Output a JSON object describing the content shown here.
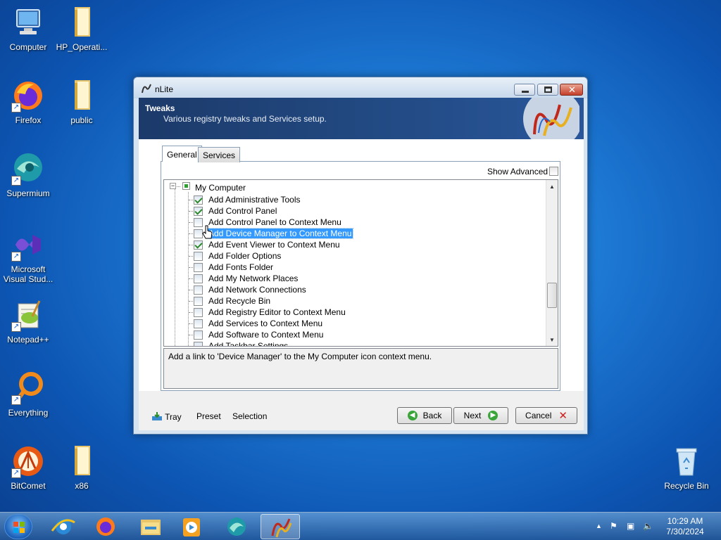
{
  "desktop": {
    "icons": [
      {
        "label": "Computer"
      },
      {
        "label": "HP_Operati..."
      },
      {
        "label": "Firefox"
      },
      {
        "label": "public"
      },
      {
        "label": "Supermium"
      },
      {
        "label": "Microsoft Visual Stud..."
      },
      {
        "label": "Notepad++"
      },
      {
        "label": "Everything"
      },
      {
        "label": "BitComet"
      },
      {
        "label": "x86"
      },
      {
        "label": "Recycle Bin"
      }
    ]
  },
  "window": {
    "title": "nLite",
    "header_title": "Tweaks",
    "header_subtitle": "Various registry tweaks and Services setup.",
    "tabs": [
      {
        "label": "General",
        "active": true
      },
      {
        "label": "Services",
        "active": false
      }
    ],
    "show_advanced_label": "Show Advanced",
    "show_advanced_checked": false,
    "tree_root": "My Computer",
    "tree_items": [
      {
        "label": "Add Administrative Tools",
        "checked": true
      },
      {
        "label": "Add Control Panel",
        "checked": true
      },
      {
        "label": "Add Control Panel to Context Menu",
        "checked": false
      },
      {
        "label": "Add Device Manager to Context Menu",
        "checked": false,
        "selected": true
      },
      {
        "label": "Add Event Viewer to Context Menu",
        "checked": true
      },
      {
        "label": "Add Folder Options",
        "checked": false
      },
      {
        "label": "Add Fonts Folder",
        "checked": false
      },
      {
        "label": "Add My Network Places",
        "checked": false
      },
      {
        "label": "Add Network Connections",
        "checked": false
      },
      {
        "label": "Add Recycle Bin",
        "checked": false
      },
      {
        "label": "Add Registry Editor to Context Menu",
        "checked": false
      },
      {
        "label": "Add Services to Context Menu",
        "checked": false
      },
      {
        "label": "Add Software to Context Menu",
        "checked": false
      },
      {
        "label": "Add Taskbar Settings",
        "checked": false
      }
    ],
    "description": "Add a link to 'Device Manager' to the My Computer icon context menu.",
    "footer_links": [
      {
        "label": "Tray"
      },
      {
        "label": "Preset"
      },
      {
        "label": "Selection"
      }
    ],
    "buttons": {
      "back": "Back",
      "next": "Next",
      "cancel": "Cancel"
    }
  },
  "taskbar": {
    "time": "10:29 AM",
    "date": "7/30/2024",
    "pinned": [
      "internet-explorer-icon",
      "firefox-icon",
      "file-explorer-icon",
      "media-player-icon",
      "supermium-icon",
      "nlite-icon"
    ]
  },
  "colors": {
    "header_bg": "#234c86",
    "selection": "#3399ff",
    "check_green": "#2a8a2a"
  }
}
